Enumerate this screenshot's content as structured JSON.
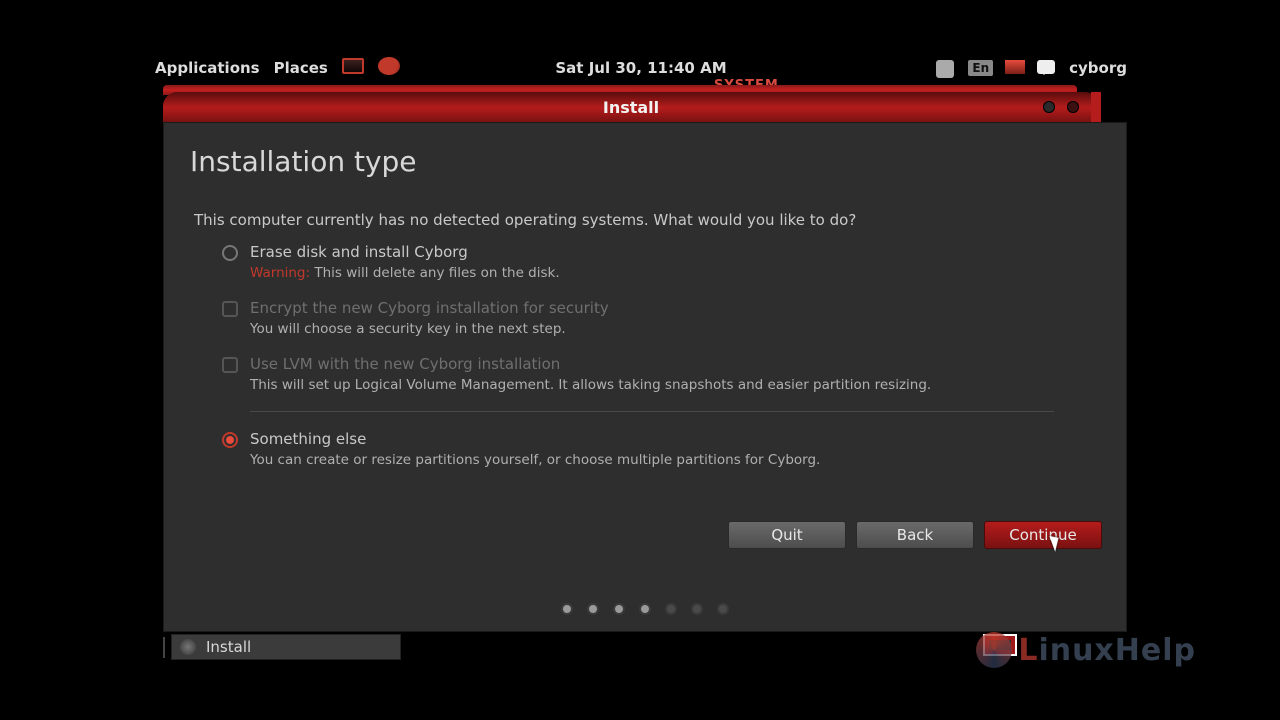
{
  "panel": {
    "menu_apps": "Applications",
    "menu_places": "Places",
    "datetime": "Sat Jul 30, 11:40 AM",
    "lang": "En",
    "user": "cyborg"
  },
  "ribbon_label": "SYSTEM",
  "titlebar": {
    "title": "Install"
  },
  "page": {
    "heading": "Installation type",
    "intro": "This computer currently has no detected operating systems. What would you like to do?",
    "options": {
      "erase": {
        "label": "Erase disk and install Cyborg",
        "warning_prefix": "Warning:",
        "warning_text": " This will delete any files on the disk."
      },
      "encrypt": {
        "label": "Encrypt the new Cyborg installation for security",
        "sub": "You will choose a security key in the next step."
      },
      "lvm": {
        "label": "Use LVM with the new Cyborg installation",
        "sub": "This will set up Logical Volume Management. It allows taking snapshots and easier partition resizing."
      },
      "else": {
        "label": "Something else",
        "sub": "You can create or resize partitions yourself, or choose multiple partitions for Cyborg."
      }
    },
    "buttons": {
      "quit": "Quit",
      "back": "Back",
      "continue": "Continue"
    },
    "steps": {
      "total": 7,
      "current": 4
    }
  },
  "taskbar": {
    "task_install": "Install"
  },
  "watermark": {
    "text_l": "L",
    "text_rest": "inuxHelp"
  }
}
